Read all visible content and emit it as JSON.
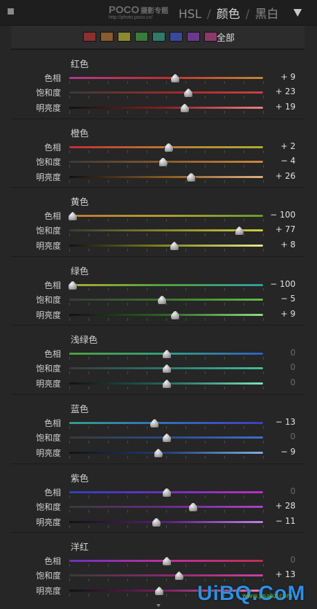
{
  "header": {
    "logo_main": "POCO",
    "logo_cn": "摄影专题",
    "logo_url": "http://photo.poco.cn/",
    "tab_hsl": "HSL",
    "sep1": "/",
    "tab_color": "颜色",
    "sep2": "/",
    "tab_bw": "黑白"
  },
  "swatches": {
    "colors": [
      "#8a3030",
      "#8a5a30",
      "#8a8a30",
      "#3a7a3a",
      "#2f7a6a",
      "#3a4a9a",
      "#6a3a8a",
      "#8a3a6a"
    ],
    "all_label": "全部"
  },
  "row_labels": {
    "hue": "色相",
    "sat": "饱和度",
    "lum": "明亮度"
  },
  "sections": [
    {
      "title": "红色",
      "rows": [
        {
          "value": "+ 9",
          "level": 9,
          "track": [
            "#b03a8a",
            "#c03030",
            "#c08a30"
          ]
        },
        {
          "value": "+ 23",
          "level": 23,
          "track": [
            "#3a3a3a",
            "#9a2a2a",
            "#d04040"
          ]
        },
        {
          "value": "+ 19",
          "level": 19,
          "track": [
            "#111111",
            "#8a2020",
            "#f08080"
          ]
        }
      ]
    },
    {
      "title": "橙色",
      "rows": [
        {
          "value": "+ 2",
          "level": 2,
          "track": [
            "#c03030",
            "#c07a30",
            "#b0b030"
          ]
        },
        {
          "value": "− 4",
          "level": -4,
          "track": [
            "#3a3a3a",
            "#8a5a2a",
            "#d08a40"
          ]
        },
        {
          "value": "+ 26",
          "level": 26,
          "track": [
            "#111111",
            "#8a5a20",
            "#e0b080"
          ]
        }
      ]
    },
    {
      "title": "黄色",
      "rows": [
        {
          "value": "− 100",
          "level": -100,
          "track": [
            "#c07a30",
            "#b0a030",
            "#60a030"
          ]
        },
        {
          "value": "+ 77",
          "level": 77,
          "track": [
            "#3a3a3a",
            "#8a8a2a",
            "#d0d040"
          ]
        },
        {
          "value": "+ 8",
          "level": 8,
          "track": [
            "#111111",
            "#8a8a20",
            "#e8e890"
          ]
        }
      ]
    },
    {
      "title": "绿色",
      "rows": [
        {
          "value": "− 100",
          "level": -100,
          "track": [
            "#b0b030",
            "#50a040",
            "#30a0a0"
          ]
        },
        {
          "value": "− 5",
          "level": -5,
          "track": [
            "#3a3a3a",
            "#3a7a2a",
            "#60c040"
          ]
        },
        {
          "value": "+ 9",
          "level": 9,
          "track": [
            "#111111",
            "#2a6a20",
            "#90e080"
          ]
        }
      ]
    },
    {
      "title": "浅绿色",
      "rows": [
        {
          "value": "0",
          "level": 0,
          "track": [
            "#50a040",
            "#30a080",
            "#3060c0"
          ]
        },
        {
          "value": "0",
          "level": 0,
          "track": [
            "#3a3a3a",
            "#2a7a6a",
            "#40c0a0"
          ]
        },
        {
          "value": "0",
          "level": 0,
          "track": [
            "#111111",
            "#206a5a",
            "#80e0c0"
          ]
        }
      ]
    },
    {
      "title": "蓝色",
      "rows": [
        {
          "value": "− 13",
          "level": -13,
          "track": [
            "#30a090",
            "#3070c0",
            "#4040c0"
          ]
        },
        {
          "value": "0",
          "level": 0,
          "track": [
            "#3a3a3a",
            "#2a4a8a",
            "#4070d0"
          ]
        },
        {
          "value": "− 9",
          "level": -9,
          "track": [
            "#111111",
            "#20407a",
            "#80b0e8"
          ]
        }
      ]
    },
    {
      "title": "紫色",
      "rows": [
        {
          "value": "0",
          "level": 0,
          "track": [
            "#3040c0",
            "#7030c0",
            "#c030c0"
          ]
        },
        {
          "value": "+ 28",
          "level": 28,
          "track": [
            "#3a3a3a",
            "#6a2a8a",
            "#b040d0"
          ]
        },
        {
          "value": "− 11",
          "level": -11,
          "track": [
            "#111111",
            "#5a207a",
            "#c080e8"
          ]
        }
      ]
    },
    {
      "title": "洋红",
      "rows": [
        {
          "value": "0",
          "level": 0,
          "track": [
            "#7030c0",
            "#c030a0",
            "#c03050"
          ]
        },
        {
          "value": "+ 13",
          "level": 13,
          "track": [
            "#3a3a3a",
            "#8a2a6a",
            "#d040a0"
          ]
        },
        {
          "value": "",
          "level": -8,
          "track": [
            "#111111",
            "#7a2060",
            "#e880c0"
          ]
        }
      ]
    }
  ],
  "watermark": {
    "text": "UiBQ.CoM",
    "small": "www.psahz.com"
  }
}
